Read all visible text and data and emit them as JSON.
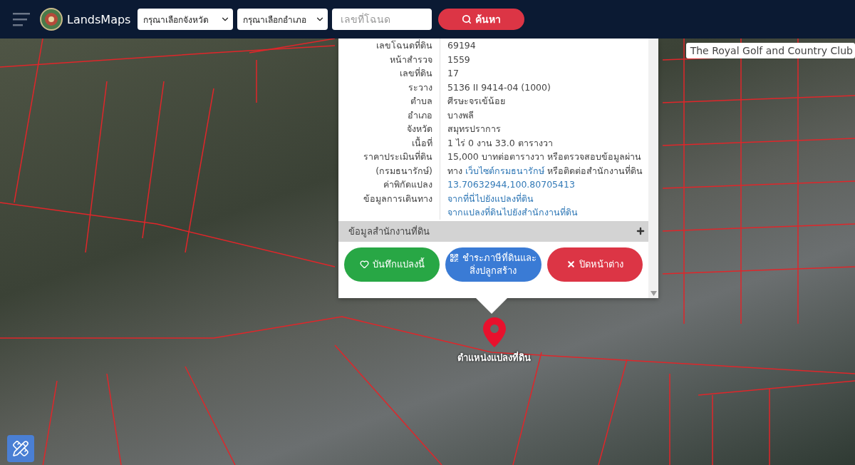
{
  "header": {
    "brand": "LandsMaps",
    "province_select": "กรุณาเลือกจังหวัด",
    "district_select": "กรุณาเลือกอำเภอ",
    "deed_field": {
      "placeholder": "เลขที่โฉนด"
    },
    "search_button": "ค้นหา"
  },
  "map": {
    "place_label": "The Royal Golf and Country Club",
    "marker_label": "ตำแหน่งแปลงที่ดิน"
  },
  "popup": {
    "rows": [
      {
        "label": "เลขโฉนดที่ดิน",
        "lines": [
          [
            {
              "text": "69194",
              "link": false
            }
          ]
        ]
      },
      {
        "label": "หน้าสำรวจ",
        "lines": [
          [
            {
              "text": "1559",
              "link": false
            }
          ]
        ]
      },
      {
        "label": "เลขที่ดิน",
        "lines": [
          [
            {
              "text": "17",
              "link": false
            }
          ]
        ]
      },
      {
        "label": "ระวาง",
        "lines": [
          [
            {
              "text": "5136 II 9414-04 (1000)",
              "link": false
            }
          ]
        ]
      },
      {
        "label": "ตำบล",
        "lines": [
          [
            {
              "text": "ศีรษะจรเข้น้อย",
              "link": false
            }
          ]
        ]
      },
      {
        "label": "อำเภอ",
        "lines": [
          [
            {
              "text": "บางพลี",
              "link": false
            }
          ]
        ]
      },
      {
        "label": "จังหวัด",
        "lines": [
          [
            {
              "text": "สมุทรปราการ",
              "link": false
            }
          ]
        ]
      },
      {
        "label": "เนื้อที่",
        "lines": [
          [
            {
              "text": "1 ไร่ 0 งาน 33.0 ตารางวา",
              "link": false
            }
          ]
        ]
      },
      {
        "label": "ราคาประเมินที่ดิน",
        "lines": [
          [
            {
              "text": "15,000 บาทต่อตารางวา หรือตรวจสอบข้อมูลผ่าน",
              "link": false
            }
          ]
        ]
      },
      {
        "label": "(กรมธนารักษ์)",
        "lines": [
          [
            {
              "text": "ทาง",
              "link": false
            },
            {
              "text": "เว็บไซต์กรมธนารักษ์",
              "link": true
            },
            {
              "text": "หรือติดต่อสำนักงานที่ดิน",
              "link": false
            }
          ]
        ]
      },
      {
        "label": "ค่าพิกัดแปลง",
        "lines": [
          [
            {
              "text": "13.70632944,100.80705413",
              "link": true
            }
          ]
        ]
      },
      {
        "label": "ข้อมูลการเดินทาง",
        "lines": [
          [
            {
              "text": "จากที่นี่ไปยังแปลงที่ดิน",
              "link": true
            }
          ],
          [
            {
              "text": "จากแปลงที่ดินไปยังสำนักงานที่ดิน",
              "link": true
            }
          ]
        ]
      }
    ],
    "section": {
      "title": "ข้อมูลสำนักงานที่ดิน",
      "expanded": false
    },
    "buttons": [
      {
        "kind": "save",
        "lines": [
          "บันทึกแปลงนี้"
        ]
      },
      {
        "kind": "tax",
        "lines": [
          "ชำระภาษีที่ดินและ",
          "สิ่งปลูกสร้าง"
        ]
      },
      {
        "kind": "close",
        "lines": [
          "ปิดหน้าต่าง"
        ]
      }
    ]
  }
}
